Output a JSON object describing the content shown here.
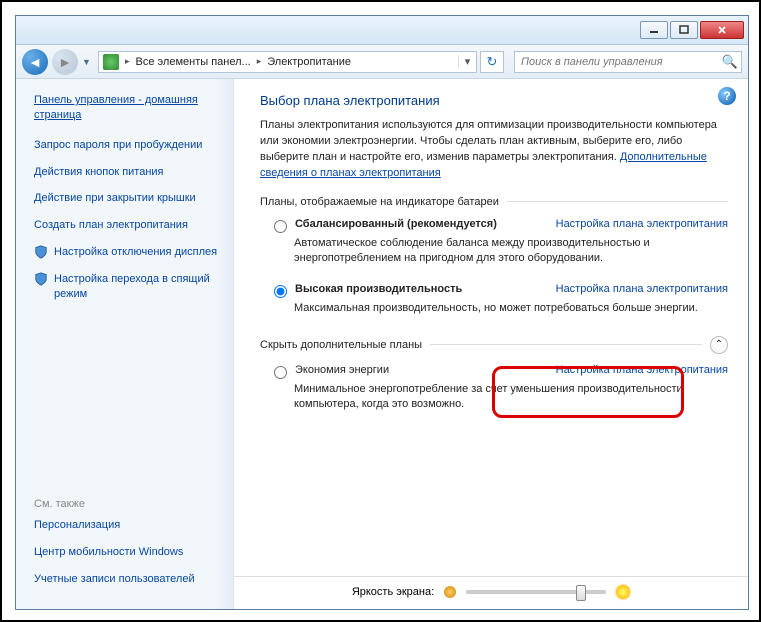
{
  "breadcrumb": {
    "seg1": "Все элементы панел...",
    "seg2": "Электропитание"
  },
  "search": {
    "placeholder": "Поиск в панели управления"
  },
  "sidebar": {
    "home": "Панель управления - домашняя страница",
    "links": [
      "Запрос пароля при пробуждении",
      "Действия кнопок питания",
      "Действие при закрытии крышки",
      "Создать план электропитания",
      "Настройка отключения дисплея",
      "Настройка перехода в спящий режим"
    ],
    "see_also_title": "См. также",
    "see_also": [
      "Персонализация",
      "Центр мобильности Windows",
      "Учетные записи пользователей"
    ]
  },
  "main": {
    "title": "Выбор плана электропитания",
    "intro_text": "Планы электропитания используются для оптимизации производительности компьютера или экономии электроэнергии. Чтобы сделать план активным, выберите его, либо выберите план и настройте его, изменив параметры электропитания. ",
    "intro_link": "Дополнительные сведения о планах электропитания",
    "group1": "Планы, отображаемые на индикаторе батареи",
    "group2": "Скрыть дополнительные планы",
    "config_link": "Настройка плана электропитания",
    "plans": [
      {
        "name": "Сбалансированный",
        "reco": "(рекомендуется)",
        "desc": "Автоматическое соблюдение баланса между производительностью и энергопотреблением на пригодном для этого оборудовании."
      },
      {
        "name": "Высокая производительность",
        "desc": "Максимальная производительность, но может потребоваться больше энергии."
      },
      {
        "name": "Экономия энергии",
        "desc": "Минимальное энергопотребление за счет уменьшения производительности компьютера, когда это возможно."
      }
    ],
    "brightness_label": "Яркость экрана:"
  }
}
